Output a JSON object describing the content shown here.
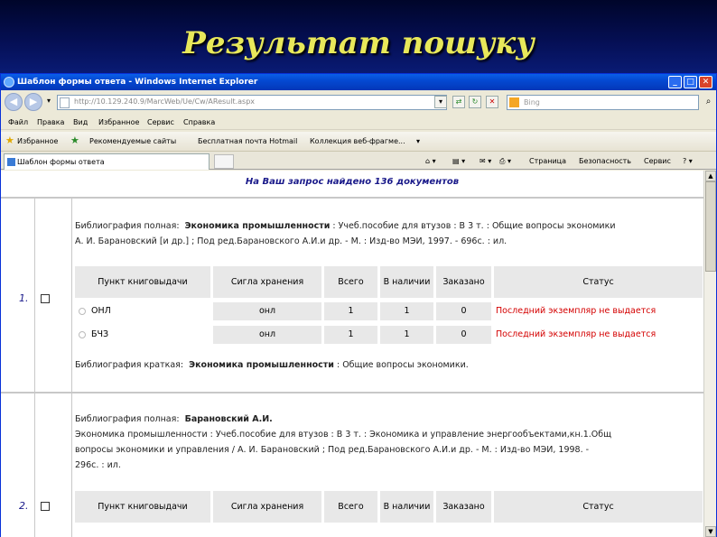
{
  "slide_title": "Результат пошуку",
  "window_title": "Шаблон формы ответа - Windows Internet Explorer",
  "address_url": "http://10.129.240.9/MarcWeb/Ue/Cw/AResult.aspx",
  "search_placeholder": "Bing",
  "menu": [
    "Файл",
    "Правка",
    "Вид",
    "Избранное",
    "Сервис",
    "Справка"
  ],
  "favorites": {
    "label": "Избранное",
    "items": [
      "Рекомендуемые сайты",
      "Бесплатная почта Hotmail",
      "Коллекция веб-фрагме..."
    ]
  },
  "tab_title": "Шаблон формы ответа",
  "tools": [
    "Страница",
    "Безопасность",
    "Сервис"
  ],
  "found_text": "На Ваш запрос найдено 136 документов",
  "table_headers": [
    "Пункт книговыдачи",
    "Сигла хранения",
    "Всего",
    "В наличии",
    "Заказано",
    "Статус"
  ],
  "records": [
    {
      "num": "1.",
      "bib_full_label": "Библиография полная:",
      "bib_full_bold": "Экономика промышленности",
      "bib_full_line1": " : Учеб.пособие для втузов : В 3 т. : Общие вопросы экономики",
      "bib_full_line2": "А. И. Барановский [и др.] ; Под ред.Барановского А.И.и др. - М. : Изд-во МЭИ, 1997. - 696с. : ил.",
      "rows": [
        {
          "point": "ОНЛ",
          "sigla": "онл",
          "total": "1",
          "available": "1",
          "ordered": "0",
          "status": "Последний экземпляр не выдается"
        },
        {
          "point": "БЧЗ",
          "sigla": "онл",
          "total": "1",
          "available": "1",
          "ordered": "0",
          "status": "Последний экземпляр не выдается"
        }
      ],
      "bib_short_label": "Библиография краткая:",
      "bib_short_bold": "Экономика промышленности",
      "bib_short_rest": " : Общие вопросы экономики."
    },
    {
      "num": "2.",
      "bib_full_label": "Библиография полная:",
      "bib_full_bold": "Барановский А.И.",
      "bib_full_line1": "Экономика промышленности : Учеб.пособие для втузов : В 3 т. : Экономика и управление энергообъектами,кн.1.Общ",
      "bib_full_line2": "вопросы экономики и управления / А. И. Барановский ; Под ред.Барановского А.И.и др. - М. : Изд-во МЭИ, 1998. -",
      "bib_full_line3": "296с. : ил."
    }
  ]
}
